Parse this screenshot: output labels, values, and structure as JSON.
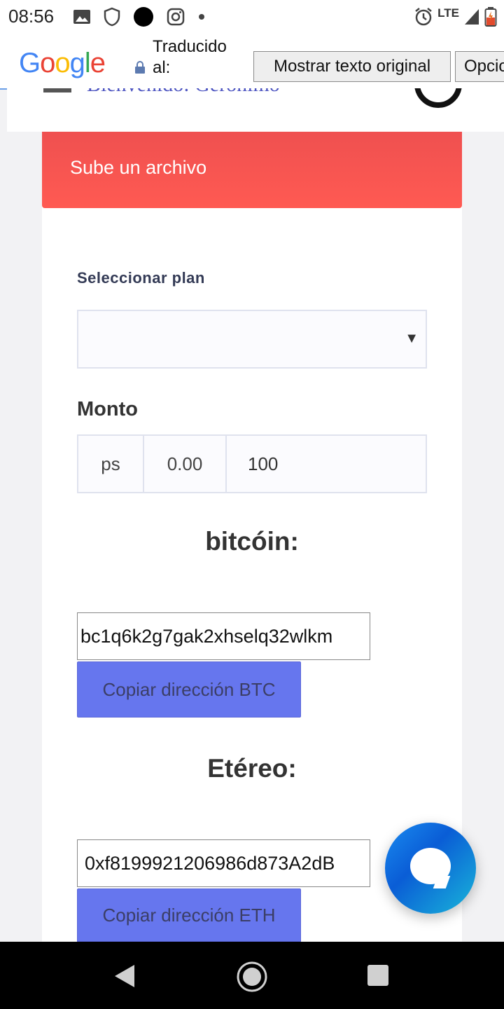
{
  "status_bar": {
    "time": "08:56",
    "network": "LTE",
    "icons": [
      "image-icon",
      "shield-icon",
      "dot-icon",
      "instagram-icon",
      "more-dot-icon",
      "alarm-icon",
      "signal-icon",
      "battery-icon"
    ]
  },
  "translate_bar": {
    "brand": "Google",
    "translated_label": "Traducido al:",
    "show_original_button": "Mostrar texto original",
    "options_button": "Opciones"
  },
  "site_header": {
    "welcome_text": "Bienvenido: Geronimo"
  },
  "upload_card": {
    "title": "Sube un archivo",
    "plan_label": "Seleccionar plan",
    "plan_selected": "",
    "amount_label": "Monto",
    "amount_prefix": "ps",
    "amount_min": "0.00",
    "amount_value": "100",
    "btc": {
      "title": "bitcóin:",
      "address": "bc1q6k2g7gak2xhselq32wlkm",
      "copy_button": "Copiar dirección BTC"
    },
    "eth": {
      "title": "Etéreo:",
      "address": "0xf8199921206986d873A2dB",
      "copy_button": "Copiar dirección ETH"
    }
  },
  "colors": {
    "header_red": "#ff5a52",
    "button_blue": "#6676ee",
    "chat_blue": "#0a5dd6"
  }
}
